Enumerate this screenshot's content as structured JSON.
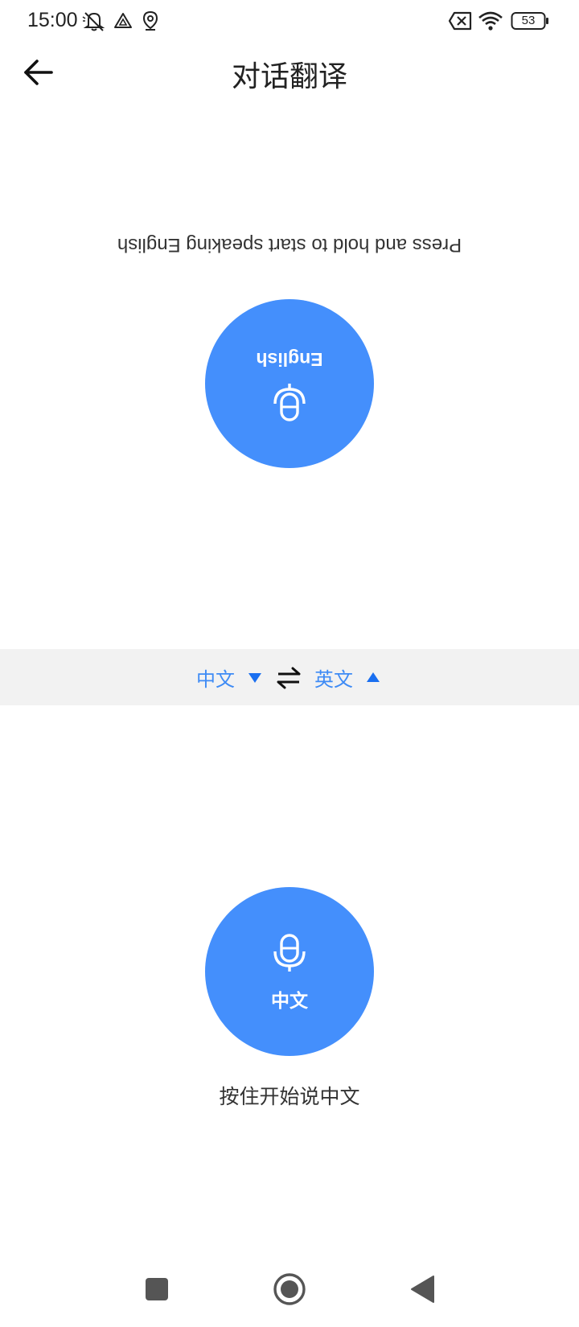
{
  "status_bar": {
    "time": "15:00",
    "battery": "53",
    "icons": [
      "mute-icon",
      "drive-icon",
      "location-icon",
      "sim-error-icon",
      "wifi-icon",
      "battery-icon"
    ]
  },
  "header": {
    "title": "对话翻译",
    "back_icon": "back-arrow-icon"
  },
  "top_speaker": {
    "hint": "Press and hold to start speaking English",
    "button_label": "English",
    "icon": "mic-icon"
  },
  "language_bar": {
    "source_language": "中文",
    "target_language": "英文",
    "swap_icon": "swap-arrows-icon",
    "accent_color": "#3e8bf5"
  },
  "bottom_speaker": {
    "button_label": "中文",
    "hint": "按住开始说中文",
    "icon": "mic-icon"
  },
  "colors": {
    "button_blue": "#448ffc",
    "lang_bar_bg": "#f2f2f2"
  },
  "nav_bar": {
    "buttons": [
      "recent-apps-icon",
      "home-icon",
      "back-triangle-icon"
    ]
  }
}
